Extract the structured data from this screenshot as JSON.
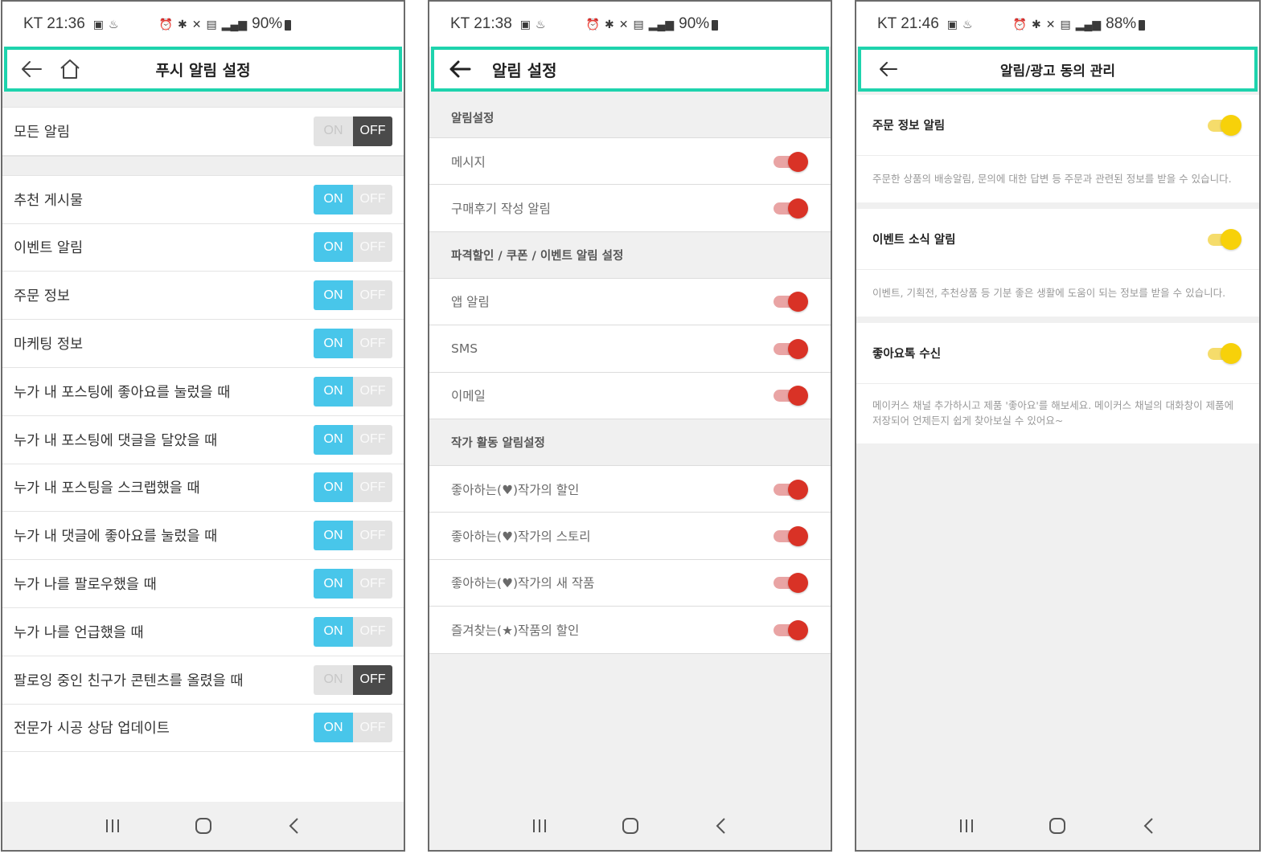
{
  "colors": {
    "highlight": "#1ed3ad",
    "on_active": "#48c6ea",
    "off_active": "#4a4a4a",
    "red_toggle": "#d93226",
    "yellow_toggle": "#f7d10a"
  },
  "panel1": {
    "status": {
      "carrier": "KT 21:36",
      "battery": "90%"
    },
    "header": {
      "title": "푸시 알림 설정"
    },
    "all_row": {
      "label": "모든 알림",
      "on": "ON",
      "off": "OFF",
      "state": "off"
    },
    "rows": [
      {
        "label": "추천 게시물",
        "on": "ON",
        "off": "OFF",
        "state": "on"
      },
      {
        "label": "이벤트 알림",
        "on": "ON",
        "off": "OFF",
        "state": "on"
      },
      {
        "label": "주문 정보",
        "on": "ON",
        "off": "OFF",
        "state": "on"
      },
      {
        "label": "마케팅 정보",
        "on": "ON",
        "off": "OFF",
        "state": "on"
      },
      {
        "label": "누가 내 포스팅에 좋아요를 눌렀을 때",
        "on": "ON",
        "off": "OFF",
        "state": "on"
      },
      {
        "label": "누가 내 포스팅에 댓글을 달았을 때",
        "on": "ON",
        "off": "OFF",
        "state": "on"
      },
      {
        "label": "누가 내 포스팅을 스크랩했을 때",
        "on": "ON",
        "off": "OFF",
        "state": "on"
      },
      {
        "label": "누가 내 댓글에 좋아요를 눌렀을 때",
        "on": "ON",
        "off": "OFF",
        "state": "on"
      },
      {
        "label": "누가 나를 팔로우했을 때",
        "on": "ON",
        "off": "OFF",
        "state": "on"
      },
      {
        "label": "누가 나를 언급했을 때",
        "on": "ON",
        "off": "OFF",
        "state": "on"
      },
      {
        "label": "팔로잉 중인 친구가 콘텐츠를 올렸을 때",
        "on": "ON",
        "off": "OFF",
        "state": "off"
      },
      {
        "label": "전문가 시공 상담 업데이트",
        "on": "ON",
        "off": "OFF",
        "state": "on"
      }
    ]
  },
  "panel2": {
    "status": {
      "carrier": "KT 21:38",
      "battery": "90%"
    },
    "header": {
      "title": "알림 설정"
    },
    "sections": [
      {
        "title": "알림설정",
        "rows": [
          {
            "label": "메시지"
          },
          {
            "label": "구매후기 작성 알림"
          }
        ]
      },
      {
        "title": "파격할인 / 쿠폰 / 이벤트 알림 설정",
        "rows": [
          {
            "label": "앱 알림"
          },
          {
            "label": "SMS"
          },
          {
            "label": "이메일"
          }
        ]
      },
      {
        "title": "작가 활동 알림설정",
        "rows": [
          {
            "label": "좋아하는(♥)작가의 할인"
          },
          {
            "label": "좋아하는(♥)작가의 스토리"
          },
          {
            "label": "좋아하는(♥)작가의 새 작품"
          },
          {
            "label": "즐겨찾는(★)작품의 할인"
          }
        ]
      }
    ]
  },
  "panel3": {
    "status": {
      "carrier": "KT 21:46",
      "battery": "88%"
    },
    "header": {
      "title": "알림/광고 동의 관리"
    },
    "items": [
      {
        "label": "주문 정보 알림",
        "desc": "주문한 상품의 배송알림, 문의에 대한 답변 등 주문과 관련된 정보를 받을 수 있습니다."
      },
      {
        "label": "이벤트 소식 알림",
        "desc": "이벤트, 기획전, 추천상품 등 기분 좋은 생활에 도움이 되는 정보를 받을 수 있습니다."
      },
      {
        "label": "좋아요톡 수신",
        "desc": "메이커스 채널 추가하시고 제품 '좋아요'를 해보세요. 메이커스 채널의 대화창이 제품에 저장되어 언제든지 쉽게 찾아보실 수 있어요~"
      }
    ]
  }
}
